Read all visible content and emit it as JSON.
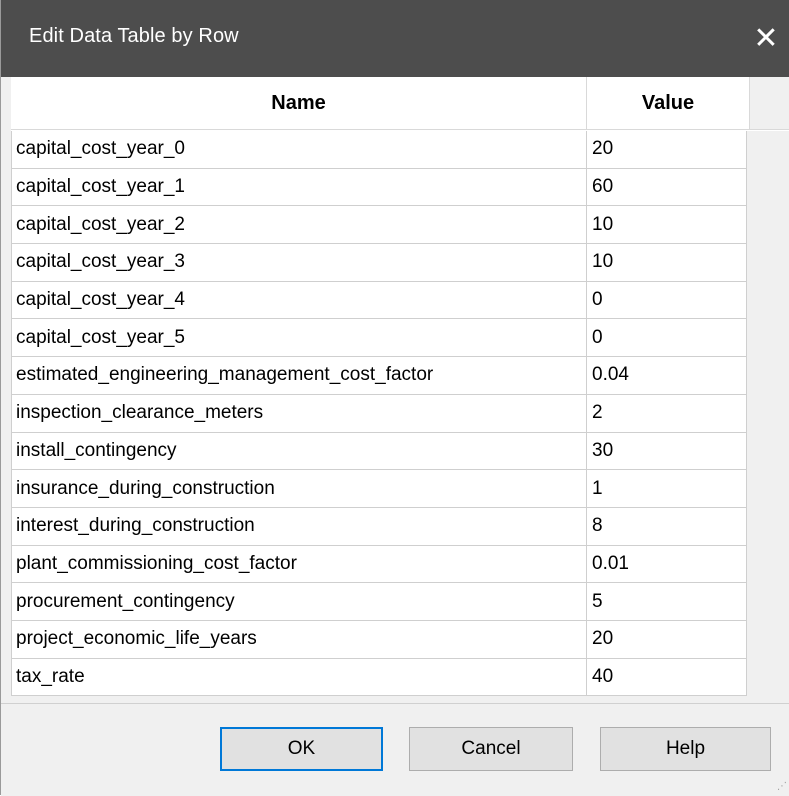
{
  "dialog": {
    "title": "Edit Data Table by Row",
    "close_glyph": "✕"
  },
  "table": {
    "columns": [
      "Name",
      "Value"
    ],
    "rows": [
      {
        "name": "capital_cost_year_0",
        "value": "20"
      },
      {
        "name": "capital_cost_year_1",
        "value": "60"
      },
      {
        "name": "capital_cost_year_2",
        "value": "10"
      },
      {
        "name": "capital_cost_year_3",
        "value": "10"
      },
      {
        "name": "capital_cost_year_4",
        "value": "0"
      },
      {
        "name": "capital_cost_year_5",
        "value": "0"
      },
      {
        "name": "estimated_engineering_management_cost_factor",
        "value": "0.04"
      },
      {
        "name": "inspection_clearance_meters",
        "value": "2"
      },
      {
        "name": "install_contingency",
        "value": "30"
      },
      {
        "name": "insurance_during_construction",
        "value": "1"
      },
      {
        "name": "interest_during_construction",
        "value": "8"
      },
      {
        "name": "plant_commissioning_cost_factor",
        "value": "0.01"
      },
      {
        "name": "procurement_contingency",
        "value": "5"
      },
      {
        "name": "project_economic_life_years",
        "value": "20"
      },
      {
        "name": "tax_rate",
        "value": "40"
      }
    ]
  },
  "buttons": {
    "ok": "OK",
    "cancel": "Cancel",
    "help": "Help"
  },
  "icons": {
    "close": "close-icon",
    "resize_grip": "resize-grip-icon"
  },
  "colors": {
    "titlebar": "#4d4d4d",
    "focus_border": "#0078d7"
  }
}
